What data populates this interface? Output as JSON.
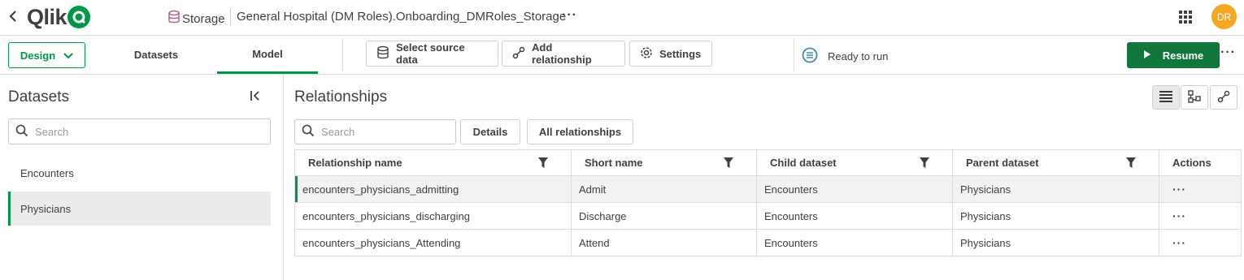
{
  "header": {
    "logo_text": "Qlik",
    "breadcrumb": "Storage",
    "app_title": "General Hospital (DM Roles).Onboarding_DMRoles_Storage",
    "more": "···",
    "avatar_initials": "DR"
  },
  "toolbar": {
    "design_label": "Design",
    "tabs": [
      {
        "label": "Datasets"
      },
      {
        "label": "Model"
      }
    ],
    "buttons": {
      "select_source": "Select source data",
      "add_relationship": "Add relationship",
      "settings": "Settings"
    },
    "status": "Ready to run",
    "resume_label": "Resume",
    "more": "···"
  },
  "sidebar": {
    "title": "Datasets",
    "search_placeholder": "Search",
    "items": [
      {
        "label": "Encounters",
        "selected": false
      },
      {
        "label": "Physicians",
        "selected": true
      }
    ]
  },
  "main": {
    "title": "Relationships",
    "search_placeholder": "Search",
    "details_label": "Details",
    "all_relationships_label": "All relationships",
    "columns": [
      "Relationship name",
      "Short name",
      "Child dataset",
      "Parent dataset",
      "Actions"
    ],
    "rows": [
      {
        "name": "encounters_physicians_admitting",
        "short": "Admit",
        "child": "Encounters",
        "parent": "Physicians",
        "actions": "···"
      },
      {
        "name": "encounters_physicians_discharging",
        "short": "Discharge",
        "child": "Encounters",
        "parent": "Physicians",
        "actions": "···"
      },
      {
        "name": "encounters_physicians_Attending",
        "short": "Attend",
        "child": "Encounters",
        "parent": "Physicians",
        "actions": "···"
      }
    ]
  },
  "colors": {
    "brand_green": "#009845",
    "resume_green": "#10763c",
    "avatar_orange": "#f5a623",
    "status_blue": "#3f8ab3"
  }
}
